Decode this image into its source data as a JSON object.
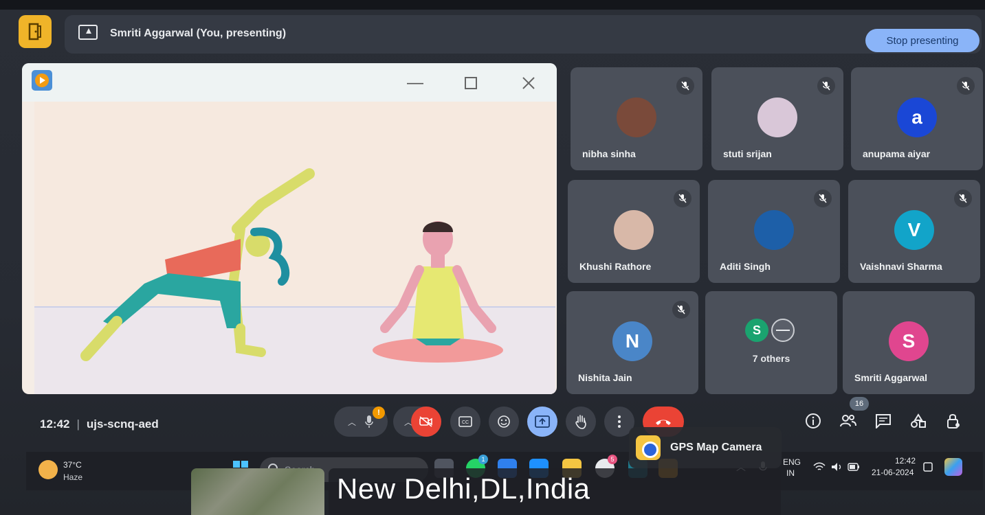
{
  "header": {
    "presenter_title": "Smriti Aggarwal (You, presenting)",
    "stop_label": "Stop presenting"
  },
  "participants": [
    {
      "name": "nibha sinha",
      "avatar_type": "photo",
      "muted": true,
      "avatar_color": "#7a4a3a"
    },
    {
      "name": "stuti srijan",
      "avatar_type": "photo",
      "muted": true,
      "avatar_color": "#d9c7d8"
    },
    {
      "name": "anupama aiyar",
      "avatar_type": "letter",
      "letter": "a",
      "muted": true,
      "avatar_color": "#1a47d6"
    },
    {
      "name": "Khushi Rathore",
      "avatar_type": "photo",
      "muted": true,
      "avatar_color": "#d8b8a8"
    },
    {
      "name": "Aditi Singh",
      "avatar_type": "photo",
      "muted": true,
      "avatar_color": "#1d5fa8"
    },
    {
      "name": "Vaishnavi Sharma",
      "avatar_type": "letter",
      "letter": "V",
      "muted": true,
      "avatar_color": "#12a4c9"
    },
    {
      "name": "Nishita Jain",
      "avatar_type": "letter",
      "letter": "N",
      "muted": true,
      "avatar_color": "#4a86c8"
    },
    {
      "name": "7 others",
      "avatar_type": "group",
      "letter": "S",
      "muted": false,
      "avatar_color": "#1aa36f"
    },
    {
      "name": "Smriti Aggarwal",
      "avatar_type": "letter",
      "letter": "S",
      "muted": false,
      "avatar_color": "#e0468f"
    }
  ],
  "meeting": {
    "time": "12:42",
    "code": "ujs-scnq-aed",
    "people_count": "16",
    "mic_alert": "!"
  },
  "taskbar": {
    "temperature": "37°C",
    "weather": "Haze",
    "search_placeholder": "Search",
    "language": "ENG",
    "region": "IN",
    "clock_time": "12:42",
    "clock_date": "21-06-2024",
    "whatsapp_badge": "1",
    "chrome_badge": "5"
  },
  "overlay": {
    "app_name": "GPS Map Camera",
    "location": "New Delhi,DL,India"
  },
  "colors": {
    "accent": "#8ab4f8",
    "end_call": "#ea4335",
    "exit_button": "#f0b429",
    "tile_bg": "#4b505a"
  }
}
